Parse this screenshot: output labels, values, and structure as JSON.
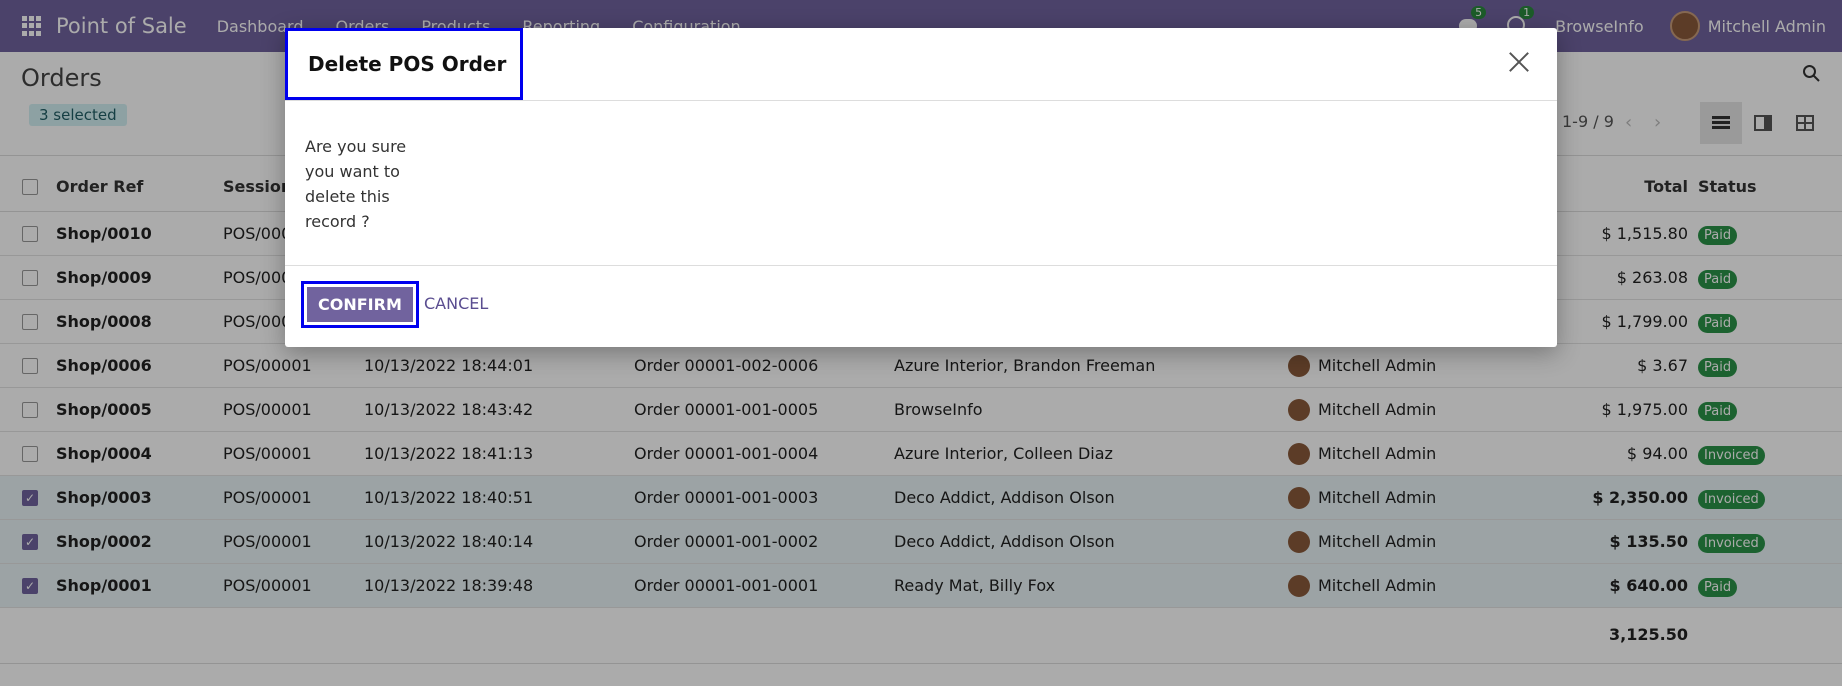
{
  "topbar": {
    "app_title": "Point of Sale",
    "menu": [
      "Dashboard",
      "Orders",
      "Products",
      "Reporting",
      "Configuration"
    ],
    "chat_count": "5",
    "activity_count": "1",
    "company": "BrowseInfo",
    "user": "Mitchell Admin"
  },
  "control": {
    "breadcrumb": "Orders",
    "selected": "3 selected",
    "pager": "1-9 / 9"
  },
  "table": {
    "headers": {
      "ref": "Order Ref",
      "session": "Session",
      "total": "Total",
      "status": "Status"
    },
    "rows": [
      {
        "ref": "Shop/0010",
        "session": "POS/000",
        "date": "",
        "receipt": "",
        "customer": "",
        "employee": "",
        "total": "$ 1,515.80",
        "status": "Paid",
        "selected": false
      },
      {
        "ref": "Shop/0009",
        "session": "POS/000",
        "date": "",
        "receipt": "",
        "customer": "",
        "employee": "",
        "total": "$ 263.08",
        "status": "Paid",
        "selected": false
      },
      {
        "ref": "Shop/0008",
        "session": "POS/000",
        "date": "",
        "receipt": "",
        "customer": "",
        "employee": "",
        "total": "$ 1,799.00",
        "status": "Paid",
        "selected": false
      },
      {
        "ref": "Shop/0006",
        "session": "POS/00001",
        "date": "10/13/2022 18:44:01",
        "receipt": "Order 00001-002-0006",
        "customer": "Azure Interior, Brandon Freeman",
        "employee": "Mitchell Admin",
        "total": "$ 3.67",
        "status": "Paid",
        "selected": false
      },
      {
        "ref": "Shop/0005",
        "session": "POS/00001",
        "date": "10/13/2022 18:43:42",
        "receipt": "Order 00001-001-0005",
        "customer": "BrowseInfo",
        "employee": "Mitchell Admin",
        "total": "$ 1,975.00",
        "status": "Paid",
        "selected": false
      },
      {
        "ref": "Shop/0004",
        "session": "POS/00001",
        "date": "10/13/2022 18:41:13",
        "receipt": "Order 00001-001-0004",
        "customer": "Azure Interior, Colleen Diaz",
        "employee": "Mitchell Admin",
        "total": "$ 94.00",
        "status": "Invoiced",
        "selected": false
      },
      {
        "ref": "Shop/0003",
        "session": "POS/00001",
        "date": "10/13/2022 18:40:51",
        "receipt": "Order 00001-001-0003",
        "customer": "Deco Addict, Addison Olson",
        "employee": "Mitchell Admin",
        "total": "$ 2,350.00",
        "status": "Invoiced",
        "selected": true
      },
      {
        "ref": "Shop/0002",
        "session": "POS/00001",
        "date": "10/13/2022 18:40:14",
        "receipt": "Order 00001-001-0002",
        "customer": "Deco Addict, Addison Olson",
        "employee": "Mitchell Admin",
        "total": "$ 135.50",
        "status": "Invoiced",
        "selected": true
      },
      {
        "ref": "Shop/0001",
        "session": "POS/00001",
        "date": "10/13/2022 18:39:48",
        "receipt": "Order 00001-001-0001",
        "customer": "Ready Mat, Billy Fox",
        "employee": "Mitchell Admin",
        "total": "$ 640.00",
        "status": "Paid",
        "selected": true
      }
    ],
    "footer_total": "3,125.50"
  },
  "dialog": {
    "title": "Delete POS Order",
    "message": "Are you sure you want to delete this record ?",
    "confirm": "CONFIRM",
    "cancel": "CANCEL"
  },
  "colors": {
    "brand": "#71639e",
    "paid": "#2b9348"
  }
}
